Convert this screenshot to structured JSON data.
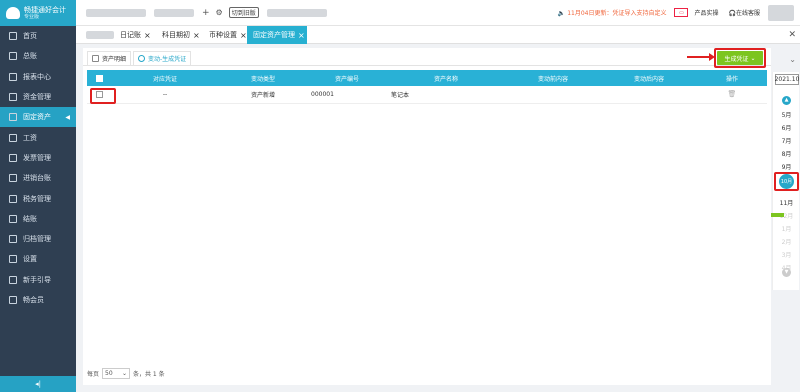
{
  "sidebar": {
    "logo_title": "畅捷通好会计",
    "logo_sub": "专业版",
    "items": [
      {
        "label": "首页",
        "icon": "home-icon"
      },
      {
        "label": "总账",
        "icon": "ledger-icon"
      },
      {
        "label": "报表中心",
        "icon": "report-icon"
      },
      {
        "label": "资金管理",
        "icon": "wallet-icon"
      },
      {
        "label": "固定资产",
        "icon": "asset-icon",
        "active": true
      },
      {
        "label": "工资",
        "icon": "salary-icon"
      },
      {
        "label": "发票管理",
        "icon": "invoice-icon"
      },
      {
        "label": "进销台账",
        "icon": "inventory-icon"
      },
      {
        "label": "税务管理",
        "icon": "tax-icon"
      },
      {
        "label": "结账",
        "icon": "closing-icon"
      },
      {
        "label": "归档管理",
        "icon": "archive-icon"
      },
      {
        "label": "设置",
        "icon": "settings-icon"
      },
      {
        "label": "新手引导",
        "icon": "guide-icon"
      },
      {
        "label": "畅会员",
        "icon": "vip-icon"
      }
    ],
    "collapse_label": "◂|"
  },
  "topbar": {
    "switch_label": "切到旧版",
    "notice": "11月04日更新：凭证导入支持自定义",
    "product_label": "产品实操",
    "service_label": "在线客服"
  },
  "tabs": [
    {
      "label": "日记账"
    },
    {
      "label": "科目期初"
    },
    {
      "label": "币种设置"
    },
    {
      "label": "固定资产管理",
      "active": true
    }
  ],
  "subtabs": [
    {
      "label": "资产明细"
    },
    {
      "label": "变动-生成凭证",
      "active": true
    }
  ],
  "generate_button": "生成凭证",
  "table": {
    "headers": [
      "对应凭证",
      "变动类型",
      "资产编号",
      "资产名称",
      "变动前内容",
      "变动后内容",
      "操作"
    ],
    "rows": [
      {
        "voucher": "--",
        "type": "资产新增",
        "code": "000001",
        "name": "笔记本",
        "before": "",
        "after": ""
      }
    ]
  },
  "pager": {
    "prefix": "每页",
    "size": "50",
    "suffix": "条，共 1 条"
  },
  "period": {
    "year": "2021.10",
    "months": [
      "5月",
      "6月",
      "7月",
      "8月",
      "9月",
      "10月",
      "11月",
      "12月",
      "1月",
      "2月",
      "3月",
      "4月"
    ],
    "current": "10月"
  }
}
